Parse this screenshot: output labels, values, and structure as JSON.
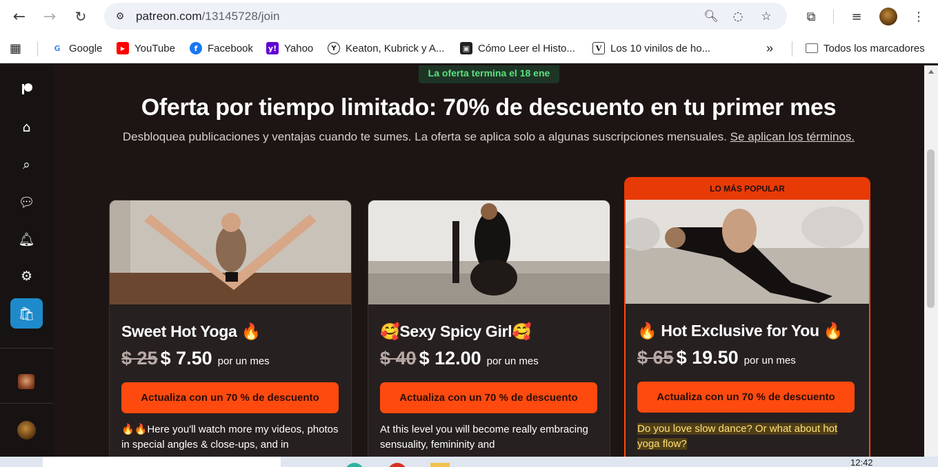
{
  "browser": {
    "url_host": "patreon.com",
    "url_path": "/13145728/join",
    "bookmarks": [
      {
        "label": "Google",
        "icon": "google-icon"
      },
      {
        "label": "YouTube",
        "icon": "youtube-icon"
      },
      {
        "label": "Facebook",
        "icon": "facebook-icon"
      },
      {
        "label": "Yahoo",
        "icon": "yahoo-icon"
      },
      {
        "label": "Keaton, Kubrick y A...",
        "icon": "site-icon"
      },
      {
        "label": "Cómo Leer el Histo...",
        "icon": "site-icon"
      },
      {
        "label": "Los 10 vinilos de ho...",
        "icon": "site-icon"
      }
    ],
    "bookmarks_overflow": "»",
    "all_bookmarks": "Todos los marcadores"
  },
  "page": {
    "offer_badge": "La oferta termina el 18 ene",
    "headline": "Oferta por tiempo limitado: 70% de descuento en tu primer mes",
    "subline": "Desbloquea publicaciones y ventajas cuando te sumes. La oferta se aplica solo a algunas suscripciones mensuales.",
    "terms_link": "Se aplican los términos.",
    "popular_label": "LO MÁS POPULAR",
    "tiers": [
      {
        "title": "Sweet Hot Yoga 🔥",
        "old_price": "$ 25",
        "new_price": "$ 7.50",
        "period": "por un mes",
        "cta": "Actualiza con un 70 % de descuento",
        "description": "🔥🔥Here you'll watch more my videos, photos in special angles & close-ups, and in"
      },
      {
        "title": "🥰Sexy Spicy Girl🥰",
        "old_price": "$ 40",
        "new_price": "$ 12.00",
        "period": "por un mes",
        "cta": "Actualiza con un 70 % de descuento",
        "description": "At this level you will become really embracing sensuality, femininity and"
      },
      {
        "title": "🔥 Hot Exclusive for You 🔥",
        "old_price": "$ 65",
        "new_price": "$ 19.50",
        "period": "por un mes",
        "cta": "Actualiza con un 70 % de descuento",
        "description": "Do you love slow dance? Or what about hot yoga flow?"
      }
    ]
  },
  "taskbar": {
    "clock": "12:42"
  },
  "colors": {
    "accent": "#ff4a0f",
    "offer_green": "#5ce07f",
    "active_rail": "#1f8acb",
    "page_bg": "#1d1513"
  }
}
